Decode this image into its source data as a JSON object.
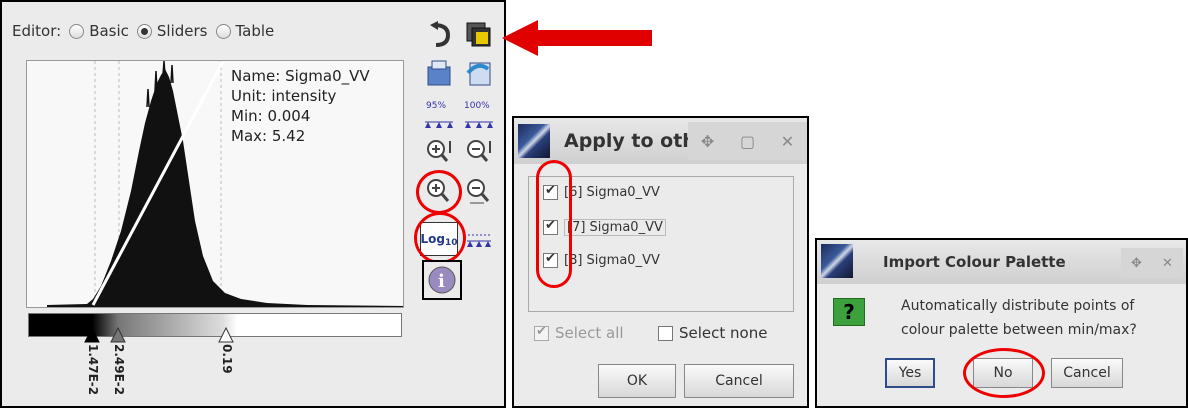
{
  "colour_editor": {
    "editor_label": "Editor:",
    "modes": [
      {
        "label": "Basic",
        "selected": false
      },
      {
        "label": "Sliders",
        "selected": true
      },
      {
        "label": "Table",
        "selected": false
      }
    ],
    "band_info": {
      "name": "Name: Sigma0_VV",
      "unit": "Unit: intensity",
      "min": "Min: 0.004",
      "max": "Max: 5.42"
    },
    "slider_values": [
      "1.47E-2",
      "2.49E-2",
      "0.19"
    ],
    "toolbar": {
      "range_95_label": "95%",
      "range_100_label": "100%",
      "log_label": "Log",
      "log_sub": "10"
    },
    "annotation_color": "#e00000"
  },
  "apply_dialog": {
    "title": "Apply to oth",
    "bands": [
      {
        "label": "[6] Sigma0_VV",
        "checked": true
      },
      {
        "label": "[7] Sigma0_VV",
        "checked": true
      },
      {
        "label": "[8] Sigma0_VV",
        "checked": true
      }
    ],
    "select_all": "Select all",
    "select_none": "Select none",
    "ok": "OK",
    "cancel": "Cancel"
  },
  "import_dialog": {
    "title": "Import Colour Palette",
    "message_line1": "Automatically distribute points of",
    "message_line2": "colour palette between min/max?",
    "yes": "Yes",
    "no": "No",
    "cancel": "Cancel",
    "icon_symbol": "?",
    "icon_color": "#3ca03c"
  }
}
